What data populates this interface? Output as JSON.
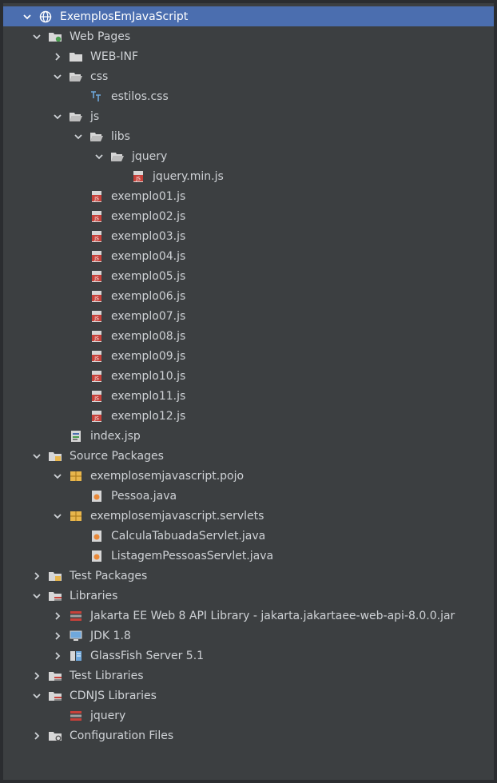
{
  "colors": {
    "background": "#3c3f41",
    "selection": "#4b6eaf",
    "text": "#cfd2d6",
    "js_badge": "#c7413a",
    "folder": "#d7d7d7",
    "package": "#e8b64c"
  },
  "tree": {
    "project": "ExemplosEmJavaScript",
    "web_pages": "Web Pages",
    "web_inf": "WEB-INF",
    "css": "css",
    "estilos": "estilos.css",
    "js": "js",
    "libs": "libs",
    "jquery_folder": "jquery",
    "jquery_min": "jquery.min.js",
    "examples": [
      "exemplo01.js",
      "exemplo02.js",
      "exemplo03.js",
      "exemplo04.js",
      "exemplo05.js",
      "exemplo06.js",
      "exemplo07.js",
      "exemplo08.js",
      "exemplo09.js",
      "exemplo10.js",
      "exemplo11.js",
      "exemplo12.js"
    ],
    "index": "index.jsp",
    "source_packages": "Source Packages",
    "pkg_pojo": "exemplosemjavascript.pojo",
    "pessoa": "Pessoa.java",
    "pkg_servlets": "exemplosemjavascript.servlets",
    "calcula": "CalculaTabuadaServlet.java",
    "listagem": "ListagemPessoasServlet.java",
    "test_packages": "Test Packages",
    "libraries": "Libraries",
    "jakarta": "Jakarta EE Web 8 API Library - jakarta.jakartaee-web-api-8.0.0.jar",
    "jdk": "JDK 1.8",
    "glassfish": "GlassFish Server 5.1",
    "test_libraries": "Test Libraries",
    "cdnjs": "CDNJS Libraries",
    "cdn_jquery": "jquery",
    "config": "Configuration Files"
  }
}
